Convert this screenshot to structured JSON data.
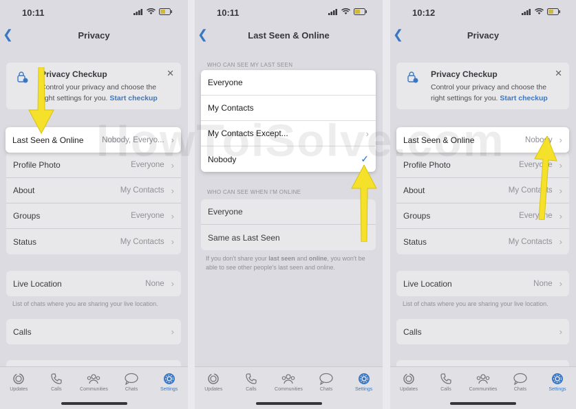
{
  "watermark": "HowToiSolve.com",
  "tabs": [
    {
      "label": "Updates",
      "icon": "updates-icon"
    },
    {
      "label": "Calls",
      "icon": "phone-icon"
    },
    {
      "label": "Communities",
      "icon": "communities-icon"
    },
    {
      "label": "Chats",
      "icon": "chats-icon"
    },
    {
      "label": "Settings",
      "icon": "settings-icon"
    }
  ],
  "colors": {
    "accent": "#1f6fd1",
    "arrow": "#f5e12a"
  },
  "panel1": {
    "time": "10:11",
    "title": "Privacy",
    "checkup": {
      "title": "Privacy Checkup",
      "desc": "Control your privacy and choose the right settings for you.",
      "link": "Start checkup"
    },
    "rows": [
      {
        "label": "Last Seen & Online",
        "value": "Nobody, Everyo..."
      },
      {
        "label": "Profile Photo",
        "value": "Everyone"
      },
      {
        "label": "About",
        "value": "My Contacts"
      },
      {
        "label": "Groups",
        "value": "Everyone"
      },
      {
        "label": "Status",
        "value": "My Contacts"
      }
    ],
    "live_location": {
      "label": "Live Location",
      "value": "None"
    },
    "live_caption": "List of chats where you are sharing your live location.",
    "calls": {
      "label": "Calls"
    }
  },
  "panel2": {
    "time": "10:11",
    "title": "Last Seen & Online",
    "last_seen_header": "WHO CAN SEE MY LAST SEEN",
    "last_seen_options": [
      "Everyone",
      "My Contacts",
      "My Contacts Except...",
      "Nobody"
    ],
    "online_header": "WHO CAN SEE WHEN I'M ONLINE",
    "online_options": [
      "Everyone",
      "Same as Last Seen"
    ],
    "footer_parts": [
      "If you don't share your ",
      "last seen",
      " and ",
      "online",
      ", you won't be able to see other people's last seen and online."
    ]
  },
  "panel3": {
    "time": "10:12",
    "title": "Privacy",
    "checkup": {
      "title": "Privacy Checkup",
      "desc": "Control your privacy and choose the right settings for you.",
      "link": "Start checkup"
    },
    "rows": [
      {
        "label": "Last Seen & Online",
        "value": "Nobody"
      },
      {
        "label": "Profile Photo",
        "value": "Everyone"
      },
      {
        "label": "About",
        "value": "My Contacts"
      },
      {
        "label": "Groups",
        "value": "Everyone"
      },
      {
        "label": "Status",
        "value": "My Contacts"
      }
    ],
    "live_location": {
      "label": "Live Location",
      "value": "None"
    },
    "live_caption": "List of chats where you are sharing your live location.",
    "calls": {
      "label": "Calls"
    }
  }
}
